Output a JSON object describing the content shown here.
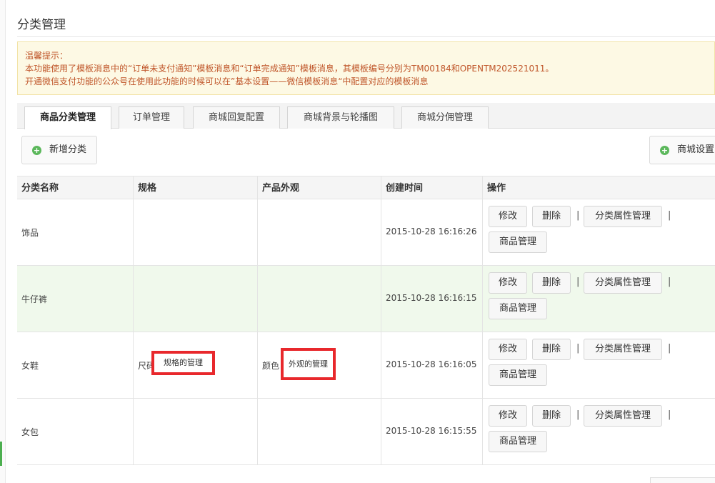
{
  "page": {
    "title": "分类管理"
  },
  "notice": {
    "heading": "温馨提示：",
    "line1": "本功能使用了模板消息中的“订单未支付通知”模板消息和“订单完成通知”模板消息，其模板编号分别为TM00184和OPENTM202521011。",
    "line2": "开通微信支付功能的公众号在使用此功能的时候可以在”基本设置——微信模板消息“中配置对应的模板消息"
  },
  "tabs": [
    {
      "label": "商品分类管理",
      "active": true
    },
    {
      "label": "订单管理"
    },
    {
      "label": "商城回复配置"
    },
    {
      "label": "商城背景与轮播图"
    },
    {
      "label": "商城分佣管理"
    }
  ],
  "toolbar": {
    "add_label": "新增分类",
    "settings_label": "商城设置"
  },
  "table": {
    "headers": [
      "分类名称",
      "规格",
      "产品外观",
      "创建时间",
      "操作"
    ],
    "rows": [
      {
        "name": "饰品",
        "spec": "",
        "look": "",
        "created": "2015-10-28 16:16:26"
      },
      {
        "name": "牛仔裤",
        "spec": "",
        "look": "",
        "created": "2015-10-28 16:16:15"
      },
      {
        "name": "女鞋",
        "spec": "尺码",
        "look": "颜色",
        "created": "2015-10-28 16:16:05"
      },
      {
        "name": "女包",
        "spec": "",
        "look": "",
        "created": "2015-10-28 16:15:55"
      }
    ],
    "actions": {
      "edit": "修改",
      "delete": "删除",
      "attr": "分类属性管理",
      "goods": "商品管理",
      "sep": "|"
    }
  },
  "annotations": {
    "spec_manage": "规格的管理",
    "look_manage": "外观的管理"
  },
  "colors": {
    "notice_text": "#c0562a",
    "highlight": "#e8282c",
    "alt_row": "#f0f9ec",
    "accent": "#5cb85c"
  }
}
